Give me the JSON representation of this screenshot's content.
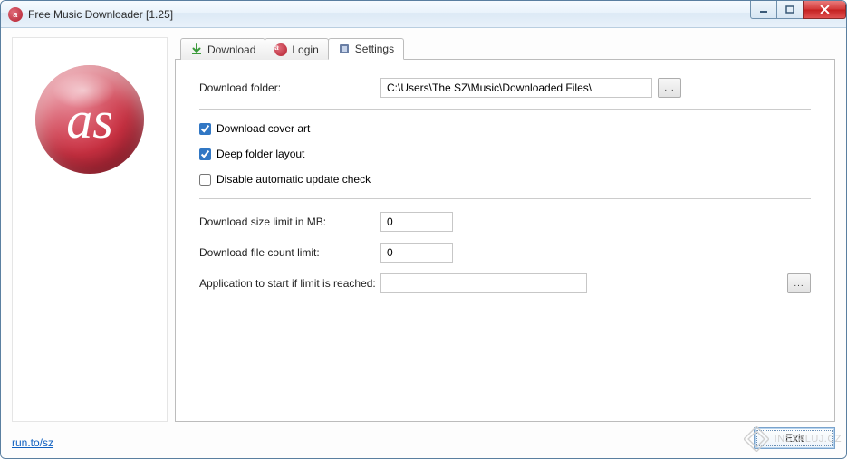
{
  "window": {
    "title": "Free Music Downloader [1.25]"
  },
  "tabs": {
    "download": "Download",
    "login": "Login",
    "settings": "Settings"
  },
  "settings": {
    "download_folder_label": "Download folder:",
    "download_folder_value": "C:\\Users\\The SZ\\Music\\Downloaded Files\\",
    "browse_label": "...",
    "cover_art_label": "Download cover art",
    "cover_art_checked": true,
    "deep_folder_label": "Deep folder layout",
    "deep_folder_checked": true,
    "disable_update_label": "Disable automatic update check",
    "disable_update_checked": false,
    "size_limit_label": "Download size limit in MB:",
    "size_limit_value": "0",
    "count_limit_label": "Download file count limit:",
    "count_limit_value": "0",
    "app_start_label": "Application to start if limit is reached:",
    "app_start_value": ""
  },
  "footer": {
    "link_text": "run.to/sz",
    "exit_label": "Exit"
  },
  "watermark": "INSTALUJ.CZ",
  "logo_text": "as"
}
